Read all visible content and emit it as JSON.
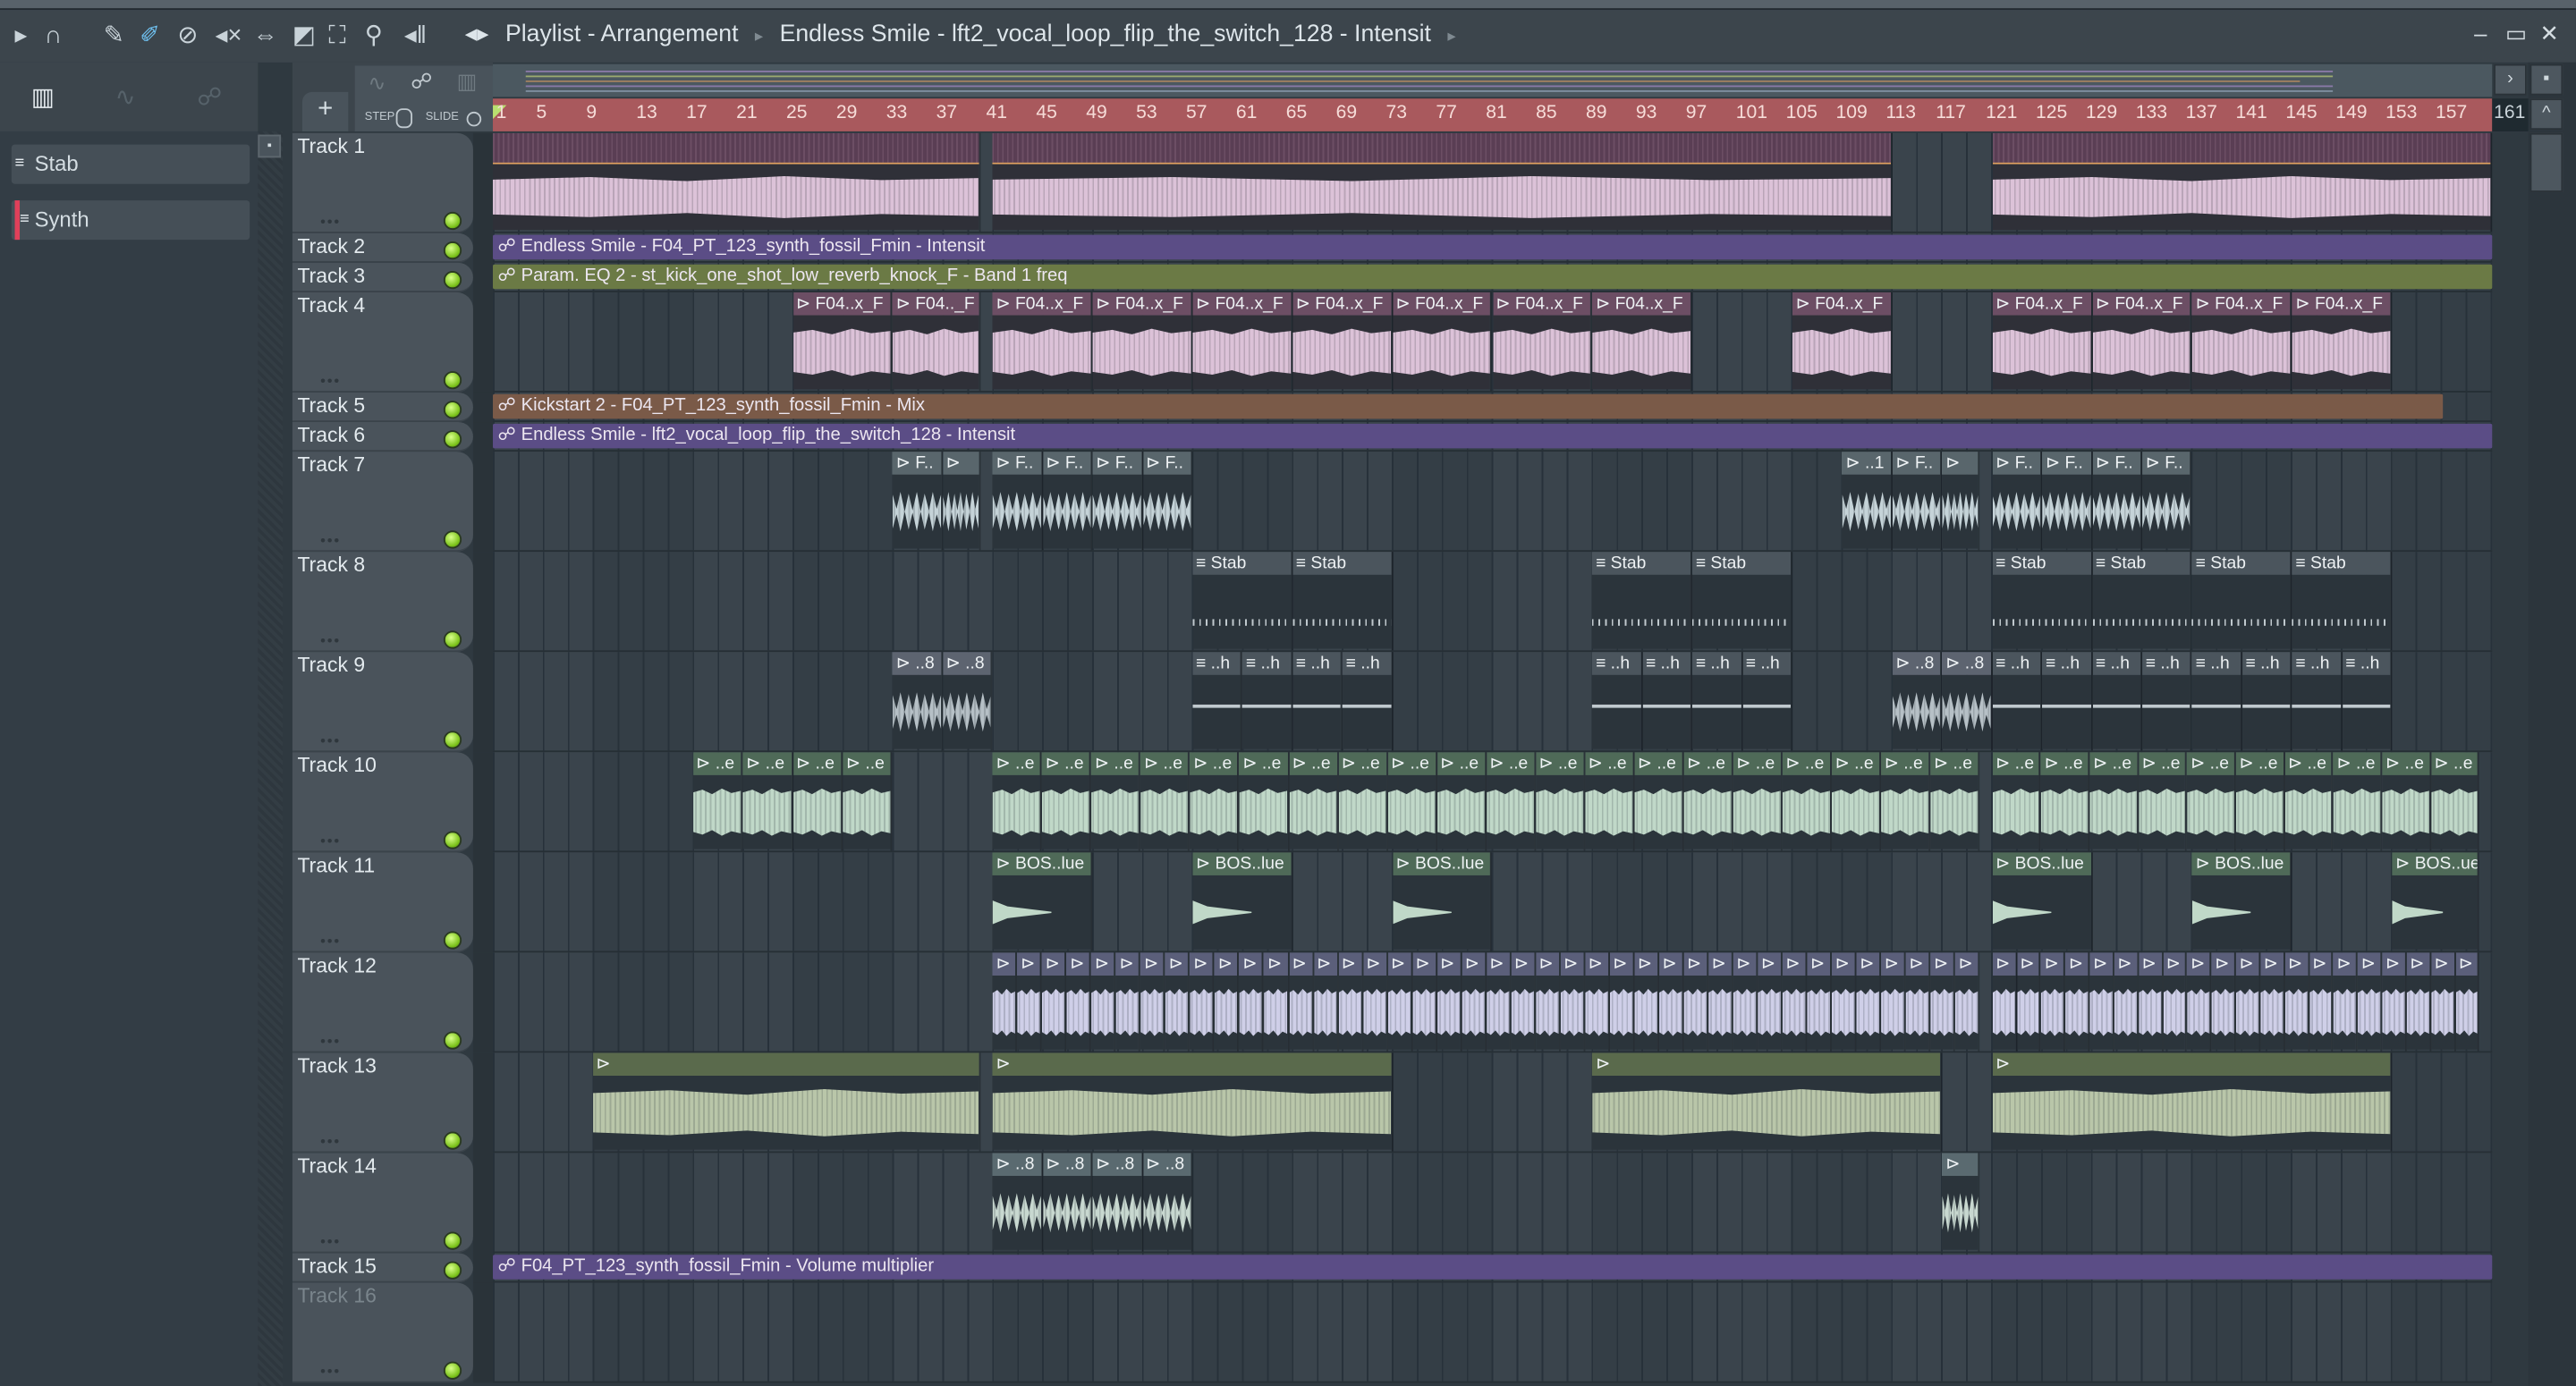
{
  "toolbar": {
    "icons": [
      "play-arrow-icon",
      "magnet-icon",
      "pencil-icon",
      "paint-brush-icon",
      "delete-icon",
      "mute-icon",
      "slip-icon",
      "slice-icon",
      "select-icon",
      "zoom-icon",
      "playback-icon"
    ],
    "breadcrumb": [
      "Playlist - Arrangement",
      "Endless Smile - lft2_vocal_loop_flip_the_switch_128 - Intensit"
    ],
    "window": {
      "minimize": "‒",
      "maximize": "▭",
      "close": "✕"
    }
  },
  "header": {
    "add": "+",
    "step": "STEP",
    "slide": "SLIDE"
  },
  "channels": [
    {
      "name": "Stab",
      "icon": "≡"
    },
    {
      "name": "Synth",
      "icon": "≡"
    }
  ],
  "ruler": {
    "ticks": [
      "1",
      "5",
      "9",
      "13",
      "17",
      "21",
      "25",
      "29",
      "33",
      "37",
      "41",
      "45",
      "49",
      "53",
      "57",
      "61",
      "65",
      "69",
      "73",
      "77",
      "81",
      "85",
      "89",
      "93",
      "97",
      "101",
      "105",
      "109",
      "113",
      "117",
      "121",
      "125",
      "129",
      "133",
      "137",
      "141",
      "145",
      "149",
      "153",
      "157"
    ],
    "end": "161"
  },
  "styles": {
    "pink": {
      "head": "#6c4e64",
      "body": "#2f3038",
      "wave": "#dcc2d8"
    },
    "slate": {
      "head": "#59666c",
      "body": "#2b343b",
      "wave": "#c5d3d8"
    },
    "pattern": {
      "head": "#4b555d",
      "body": "#2b343b",
      "wave": "#b6c0c6"
    },
    "lav": {
      "head": "#5b5f7a",
      "body": "#2b343b",
      "wave": "#cfcfe8"
    },
    "green": {
      "head": "#4f6a58",
      "body": "#2b343b",
      "wave": "#c0d8c8"
    },
    "olive": {
      "head": "#5a6a4c",
      "body": "#2b343b",
      "wave": "#b9c6a9"
    },
    "teal": {
      "head": "#5a6a70",
      "body": "#2b343b",
      "wave": "#c8d8d0"
    },
    "auto_purple": "#5b4d86",
    "auto_olive": "#6b7a45",
    "auto_brown": "#7a5a48"
  },
  "tracks": [
    {
      "name": "Track 1",
      "tall": true,
      "style": "pink",
      "clips": [
        {
          "start": 1,
          "end": 40,
          "count": 1,
          "label": ""
        },
        {
          "start": 41,
          "end": 113,
          "count": 1,
          "label": ""
        },
        {
          "start": 121,
          "end": 161,
          "count": 1,
          "label": ""
        }
      ]
    },
    {
      "name": "Track 2",
      "tall": false,
      "auto": {
        "label": "Endless Smile - F04_PT_123_synth_fossil_Fmin - Intensit",
        "color": "auto_purple",
        "start": 1,
        "end": 161
      }
    },
    {
      "name": "Track 3",
      "tall": false,
      "auto": {
        "label": "Param. EQ 2 - st_kick_one_shot_low_reverb_knock_F - Band 1 freq",
        "color": "auto_olive",
        "start": 1,
        "end": 161
      }
    },
    {
      "name": "Track 4",
      "tall": true,
      "style": "pink",
      "clips": [
        {
          "start": 25,
          "end": 33,
          "count": 1,
          "label": "F04..x_F"
        },
        {
          "start": 33,
          "end": 40,
          "count": 1,
          "label": "F04.._F"
        },
        {
          "start": 41,
          "end": 97,
          "count": 7,
          "label": "F04..x_F"
        },
        {
          "start": 105,
          "end": 113,
          "count": 1,
          "label": "F04..x_F"
        },
        {
          "start": 121,
          "end": 153,
          "count": 4,
          "label": "F04..x_F"
        }
      ]
    },
    {
      "name": "Track 5",
      "tall": false,
      "auto": {
        "label": "Kickstart 2 - F04_PT_123_synth_fossil_Fmin - Mix",
        "color": "auto_brown",
        "start": 1,
        "end": 157
      }
    },
    {
      "name": "Track 6",
      "tall": false,
      "auto": {
        "label": "Endless Smile - lft2_vocal_loop_flip_the_switch_128 - Intensit",
        "color": "auto_purple",
        "start": 1,
        "end": 161
      }
    },
    {
      "name": "Track 7",
      "tall": true,
      "style": "slate",
      "clips": [
        {
          "start": 33,
          "end": 37,
          "count": 1,
          "label": "F.."
        },
        {
          "start": 37,
          "end": 40,
          "count": 1,
          "label": ""
        },
        {
          "start": 41,
          "end": 57,
          "count": 4,
          "label": "F.."
        },
        {
          "start": 109,
          "end": 113,
          "count": 1,
          "label": "..1"
        },
        {
          "start": 113,
          "end": 117,
          "count": 1,
          "label": "F.."
        },
        {
          "start": 117,
          "end": 120,
          "count": 1,
          "label": ""
        },
        {
          "start": 121,
          "end": 137,
          "count": 4,
          "label": "F.."
        }
      ]
    },
    {
      "name": "Track 8",
      "tall": true,
      "style": "pattern",
      "pattern": true,
      "clips": [
        {
          "start": 57,
          "end": 73,
          "count": 2,
          "label": "Stab"
        },
        {
          "start": 89,
          "end": 105,
          "count": 2,
          "label": "Stab"
        },
        {
          "start": 121,
          "end": 153,
          "count": 4,
          "label": "Stab"
        }
      ]
    },
    {
      "name": "Track 9",
      "tall": true,
      "style": "pattern",
      "clips": [
        {
          "start": 33,
          "end": 41,
          "count": 2,
          "label": "..8",
          "audio": true
        },
        {
          "start": 57,
          "end": 73,
          "count": 4,
          "label": "..h",
          "pattern": true
        },
        {
          "start": 89,
          "end": 105,
          "count": 4,
          "label": "..h",
          "pattern": true
        },
        {
          "start": 113,
          "end": 121,
          "count": 2,
          "label": "..8",
          "audio": true
        },
        {
          "start": 121,
          "end": 153,
          "count": 8,
          "label": "..h",
          "pattern": true
        }
      ]
    },
    {
      "name": "Track 10",
      "tall": true,
      "style": "green",
      "clips": [
        {
          "start": 17,
          "end": 33,
          "count": 4,
          "label": "..e"
        },
        {
          "start": 41,
          "end": 120,
          "count": 20,
          "label": "..e"
        },
        {
          "start": 121,
          "end": 160,
          "count": 10,
          "label": "..e"
        }
      ]
    },
    {
      "name": "Track 11",
      "tall": true,
      "style": "green",
      "decay": true,
      "clips": [
        {
          "start": 41,
          "end": 49,
          "count": 1,
          "label": "BOS..lue"
        },
        {
          "start": 57,
          "end": 65,
          "count": 1,
          "label": "BOS..lue"
        },
        {
          "start": 73,
          "end": 81,
          "count": 1,
          "label": "BOS..lue"
        },
        {
          "start": 121,
          "end": 129,
          "count": 1,
          "label": "BOS..lue"
        },
        {
          "start": 137,
          "end": 145,
          "count": 1,
          "label": "BOS..lue"
        },
        {
          "start": 153,
          "end": 160,
          "count": 1,
          "label": "BOS..ue"
        }
      ]
    },
    {
      "name": "Track 12",
      "tall": true,
      "style": "lav",
      "clips": [
        {
          "start": 41,
          "end": 120,
          "count": 40,
          "label": ""
        },
        {
          "start": 121,
          "end": 160,
          "count": 20,
          "label": ""
        }
      ]
    },
    {
      "name": "Track 13",
      "tall": true,
      "style": "olive",
      "clips": [
        {
          "start": 9,
          "end": 40,
          "count": 1,
          "label": ""
        },
        {
          "start": 41,
          "end": 73,
          "count": 1,
          "label": ""
        },
        {
          "start": 89,
          "end": 117,
          "count": 1,
          "label": ""
        },
        {
          "start": 121,
          "end": 153,
          "count": 1,
          "label": ""
        }
      ]
    },
    {
      "name": "Track 14",
      "tall": true,
      "style": "teal",
      "clips": [
        {
          "start": 41,
          "end": 57,
          "count": 4,
          "label": "..8"
        },
        {
          "start": 117,
          "end": 120,
          "count": 1,
          "label": ""
        }
      ]
    },
    {
      "name": "Track 15",
      "tall": false,
      "auto": {
        "label": "F04_PT_123_synth_fossil_Fmin - Volume multiplier",
        "color": "auto_purple",
        "start": 1,
        "end": 161
      }
    },
    {
      "name": "Track 16",
      "tall": true,
      "dim": true,
      "clips": []
    }
  ]
}
